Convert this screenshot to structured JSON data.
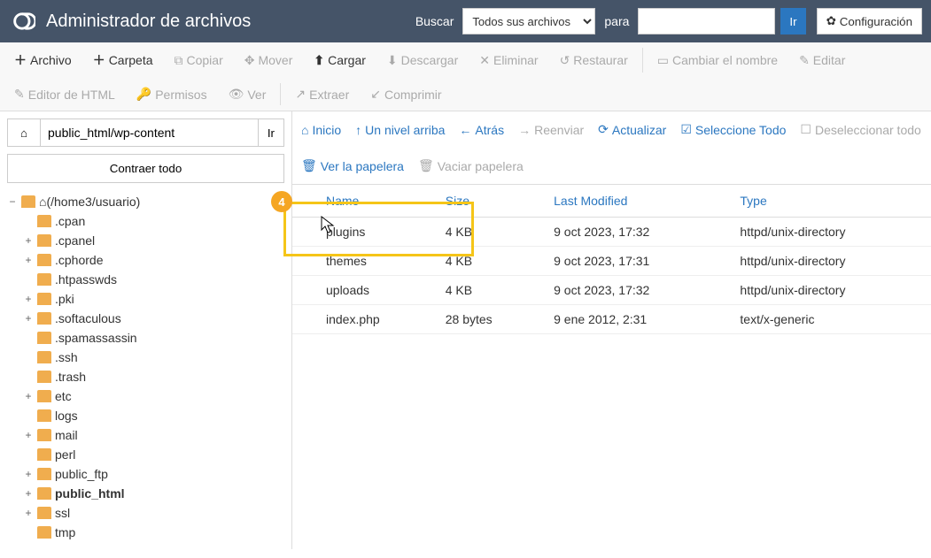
{
  "header": {
    "title": "Administrador de archivos",
    "search_label": "Buscar",
    "search_select": "Todos sus archivos",
    "search_for": "para",
    "go": "Ir",
    "config": "Configuración"
  },
  "toolbar": {
    "file": "Archivo",
    "folder": "Carpeta",
    "copy": "Copiar",
    "move": "Mover",
    "upload": "Cargar",
    "download": "Descargar",
    "delete": "Eliminar",
    "restore": "Restaurar",
    "rename": "Cambiar el nombre",
    "edit": "Editar",
    "html_editor": "Editor de HTML",
    "permissions": "Permisos",
    "view": "Ver",
    "extract": "Extraer",
    "compress": "Comprimir"
  },
  "left": {
    "path": "public_html/wp-content",
    "go": "Ir",
    "collapse": "Contraer todo",
    "root": "(/home3/usuario)",
    "nodes": [
      {
        "label": ".cpan",
        "exp": false
      },
      {
        "label": ".cpanel",
        "exp": true
      },
      {
        "label": ".cphorde",
        "exp": true
      },
      {
        "label": ".htpasswds",
        "exp": false
      },
      {
        "label": ".pki",
        "exp": true
      },
      {
        "label": ".softaculous",
        "exp": true
      },
      {
        "label": ".spamassassin",
        "exp": false
      },
      {
        "label": ".ssh",
        "exp": false
      },
      {
        "label": ".trash",
        "exp": false
      },
      {
        "label": "etc",
        "exp": true
      },
      {
        "label": "logs",
        "exp": false
      },
      {
        "label": "mail",
        "exp": true
      },
      {
        "label": "perl",
        "exp": false
      },
      {
        "label": "public_ftp",
        "exp": true
      },
      {
        "label": "public_html",
        "exp": true,
        "bold": true
      },
      {
        "label": "ssl",
        "exp": true
      },
      {
        "label": "tmp",
        "exp": false
      }
    ]
  },
  "right_toolbar": {
    "home": "Inicio",
    "up": "Un nivel arriba",
    "back": "Atrás",
    "forward": "Reenviar",
    "reload": "Actualizar",
    "select_all": "Seleccione Todo",
    "deselect_all": "Deseleccionar todo",
    "view_trash": "Ver la papelera",
    "empty_trash": "Vaciar papelera"
  },
  "columns": {
    "name": "Name",
    "size": "Size",
    "modified": "Last Modified",
    "type": "Type"
  },
  "files": [
    {
      "name": "plugins",
      "size": "4 KB",
      "modified": "9 oct 2023, 17:32",
      "type": "httpd/unix-directory",
      "kind": "folder"
    },
    {
      "name": "themes",
      "size": "4 KB",
      "modified": "9 oct 2023, 17:31",
      "type": "httpd/unix-directory",
      "kind": "folder"
    },
    {
      "name": "uploads",
      "size": "4 KB",
      "modified": "9 oct 2023, 17:32",
      "type": "httpd/unix-directory",
      "kind": "folder"
    },
    {
      "name": "index.php",
      "size": "28 bytes",
      "modified": "9 ene 2012, 2:31",
      "type": "text/x-generic",
      "kind": "file"
    }
  ],
  "annotation": {
    "badge": "4"
  }
}
